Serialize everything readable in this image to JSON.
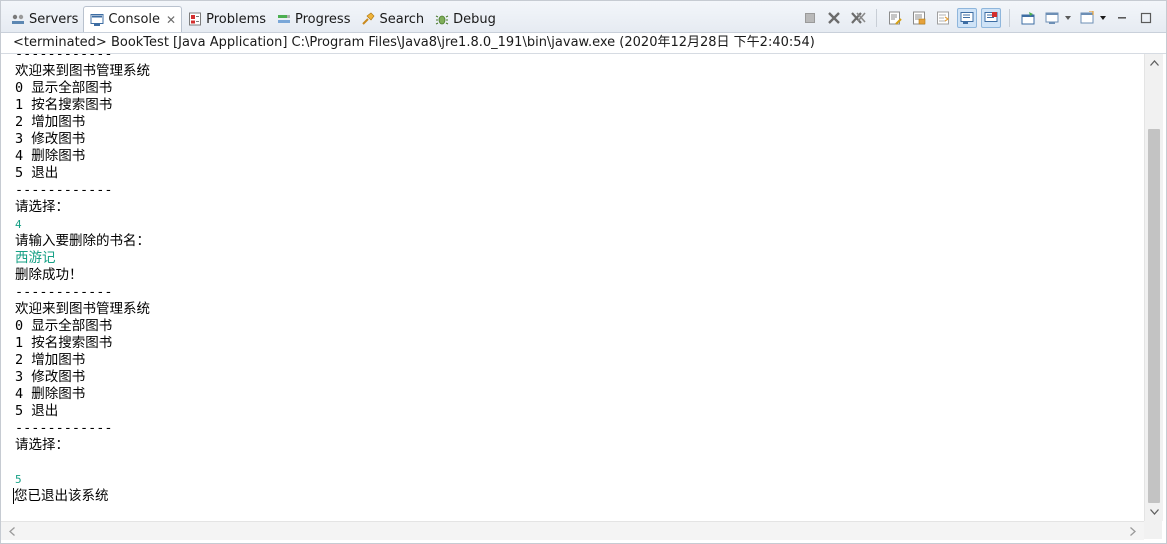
{
  "tabs": [
    {
      "label": "Servers",
      "icon": "servers-icon",
      "active": false
    },
    {
      "label": "Console",
      "icon": "console-icon",
      "active": true,
      "close": "✕"
    },
    {
      "label": "Problems",
      "icon": "problems-icon",
      "active": false
    },
    {
      "label": "Progress",
      "icon": "progress-icon",
      "active": false
    },
    {
      "label": "Search",
      "icon": "search-icon",
      "active": false
    },
    {
      "label": "Debug",
      "icon": "debug-icon",
      "active": false
    }
  ],
  "toolbar": {
    "icons": [
      "terminate-icon",
      "remove-launch-icon",
      "remove-all-terminated-icon",
      "clear-console-icon",
      "scroll-lock-icon",
      "word-wrap-icon",
      "show-on-stdout-icon",
      "show-on-stderr-icon",
      "pin-console-icon",
      "display-selected-console-icon",
      "open-console-icon",
      "view-menu-icon",
      "minimize-icon",
      "maximize-icon"
    ]
  },
  "status": "<terminated> BookTest [Java Application] C:\\Program Files\\Java8\\jre1.8.0_191\\bin\\javaw.exe (2020年12月28日 下午2:40:54)",
  "console": {
    "lines": [
      {
        "text": "------------",
        "type": "out"
      },
      {
        "text": "欢迎来到图书管理系统",
        "type": "out"
      },
      {
        "text": "0 显示全部图书",
        "type": "out"
      },
      {
        "text": "1 按名搜索图书",
        "type": "out"
      },
      {
        "text": "2 增加图书",
        "type": "out"
      },
      {
        "text": "3 修改图书",
        "type": "out"
      },
      {
        "text": "4 删除图书",
        "type": "out"
      },
      {
        "text": "5 退出",
        "type": "out"
      },
      {
        "text": "------------",
        "type": "out"
      },
      {
        "text": "请选择：",
        "type": "out"
      },
      {
        "text": "4",
        "type": "input"
      },
      {
        "text": "请输入要删除的书名：",
        "type": "out"
      },
      {
        "text": "西游记",
        "type": "input"
      },
      {
        "text": "删除成功！",
        "type": "out"
      },
      {
        "text": "------------",
        "type": "out"
      },
      {
        "text": "欢迎来到图书管理系统",
        "type": "out"
      },
      {
        "text": "0 显示全部图书",
        "type": "out"
      },
      {
        "text": "1 按名搜索图书",
        "type": "out"
      },
      {
        "text": "2 增加图书",
        "type": "out"
      },
      {
        "text": "3 修改图书",
        "type": "out"
      },
      {
        "text": "4 删除图书",
        "type": "out"
      },
      {
        "text": "5 退出",
        "type": "out"
      },
      {
        "text": "------------",
        "type": "out"
      },
      {
        "text": "请选择：",
        "type": "out"
      },
      {
        "text": "",
        "type": "out"
      },
      {
        "text": "5",
        "type": "input"
      },
      {
        "text": "您已退出该系统",
        "type": "out",
        "caret": true
      }
    ]
  },
  "colors": {
    "input_text": "#16a085",
    "tab_border": "#b9c2ce",
    "scroll_thumb": "#c3c3c3"
  }
}
